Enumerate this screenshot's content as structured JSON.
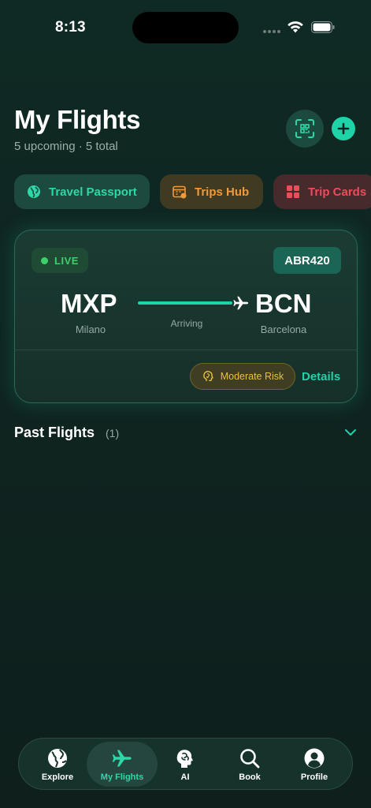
{
  "status_bar": {
    "time": "8:13"
  },
  "header": {
    "title": "My Flights",
    "subtitle": "5 upcoming · 5 total",
    "scan_icon": "qr-scan-icon",
    "add_icon": "plus-icon"
  },
  "chips": [
    {
      "label": "Travel Passport",
      "icon": "globe-icon",
      "color": "#2fd7a8"
    },
    {
      "label": "Trips Hub",
      "icon": "calendar-icon",
      "color": "#f29a3a"
    },
    {
      "label": "Trip Cards",
      "icon": "grid-icon",
      "color": "#ef4b5a"
    }
  ],
  "flight_card": {
    "status": "LIVE",
    "flight_number": "ABR420",
    "origin_code": "MXP",
    "origin_city": "Milano",
    "destination_code": "BCN",
    "destination_city": "Barcelona",
    "route_status": "Arriving",
    "risk_label": "Moderate Risk",
    "details_label": "Details"
  },
  "past_flights": {
    "label": "Past Flights",
    "count": "(1)"
  },
  "tab_bar": {
    "tabs": [
      {
        "label": "Explore",
        "icon": "globe-icon",
        "active": false
      },
      {
        "label": "My Flights",
        "icon": "airplane-icon",
        "active": true
      },
      {
        "label": "AI",
        "icon": "brain-icon",
        "active": false
      },
      {
        "label": "Book",
        "icon": "search-icon",
        "active": false
      },
      {
        "label": "Profile",
        "icon": "person-icon",
        "active": false
      }
    ]
  },
  "colors": {
    "accent": "#1ed3a8",
    "live": "#3fcf6a",
    "warning": "#e7c23a",
    "background": "#0f2420"
  }
}
